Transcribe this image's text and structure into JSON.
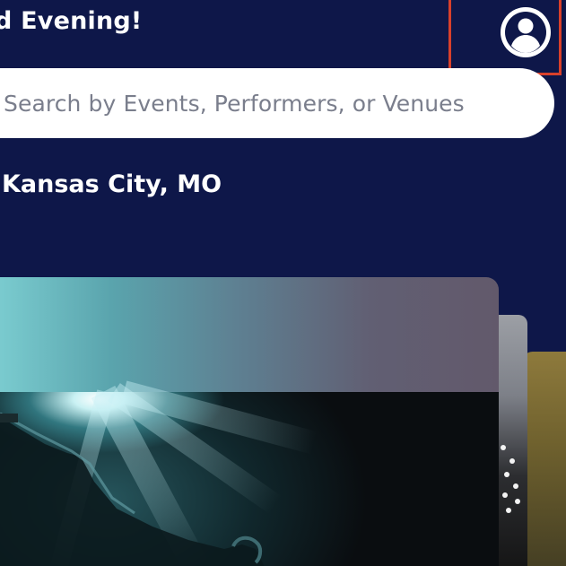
{
  "header": {
    "greeting": "d Evening!"
  },
  "search": {
    "placeholder": "Search by Events, Performers, or Venues"
  },
  "location": {
    "label": "Kansas City, MO"
  },
  "colors": {
    "background": "#0e1749",
    "highlight": "#d8402b",
    "text": "#ffffff",
    "placeholder": "#7a7e8c"
  },
  "icons": {
    "profile": "account-circle-icon"
  }
}
